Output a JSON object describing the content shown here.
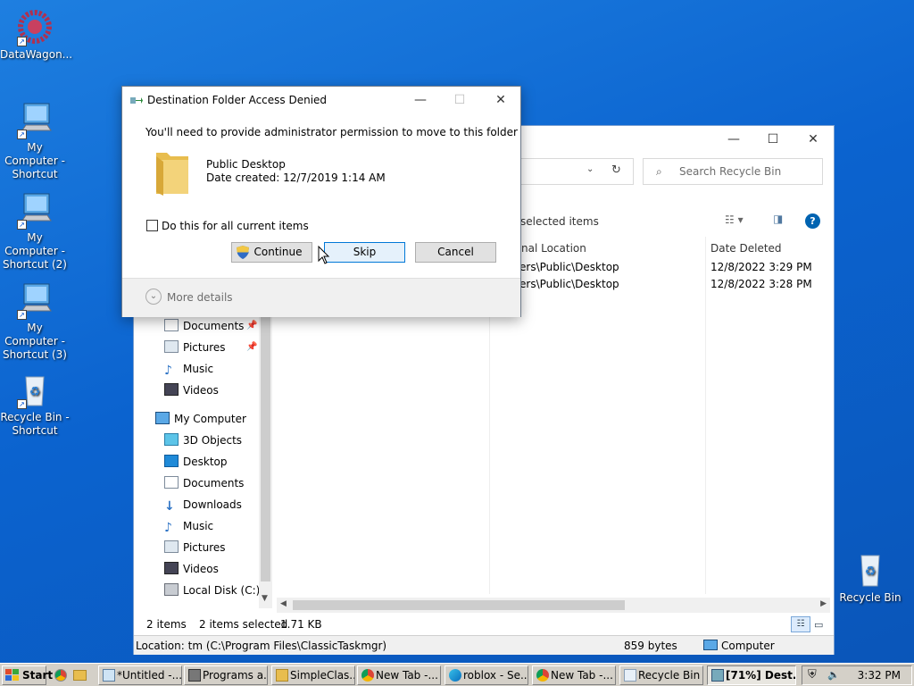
{
  "desktop": {
    "icons": [
      {
        "label": "DataWagon...",
        "shortcut": true
      },
      {
        "label": "My Computer - Shortcut",
        "shortcut": true
      },
      {
        "label": "My Computer - Shortcut (2)",
        "shortcut": true
      },
      {
        "label": "My Computer - Shortcut (3)",
        "shortcut": true
      },
      {
        "label": "Recycle Bin - Shortcut",
        "shortcut": true
      },
      {
        "label": "Recycle Bin",
        "shortcut": false
      }
    ]
  },
  "explorer": {
    "search_placeholder": "Search Recycle Bin",
    "command_label": "selected items",
    "columns": {
      "location": "nal Location",
      "date_deleted": "Date Deleted"
    },
    "rows": [
      {
        "location": "ers\\Public\\Desktop",
        "date_deleted": "12/8/2022 3:29 PM"
      },
      {
        "location": "ers\\Public\\Desktop",
        "date_deleted": "12/8/2022 3:28 PM"
      }
    ],
    "nav_items": [
      {
        "label": "Documents",
        "pinned": true,
        "indent": 1
      },
      {
        "label": "Pictures",
        "pinned": true,
        "indent": 1
      },
      {
        "label": "Music",
        "pinned": false,
        "indent": 1
      },
      {
        "label": "Videos",
        "pinned": false,
        "indent": 1
      },
      {
        "label": "My Computer",
        "pinned": false,
        "indent": 0
      },
      {
        "label": "3D Objects",
        "pinned": false,
        "indent": 1
      },
      {
        "label": "Desktop",
        "pinned": false,
        "indent": 1
      },
      {
        "label": "Documents",
        "pinned": false,
        "indent": 1
      },
      {
        "label": "Downloads",
        "pinned": false,
        "indent": 1
      },
      {
        "label": "Music",
        "pinned": false,
        "indent": 1
      },
      {
        "label": "Pictures",
        "pinned": false,
        "indent": 1
      },
      {
        "label": "Videos",
        "pinned": false,
        "indent": 1
      },
      {
        "label": "Local Disk (C:)",
        "pinned": false,
        "indent": 1
      }
    ],
    "status": {
      "count": "2 items",
      "selected": "2 items selected",
      "size": "1.71 KB"
    },
    "info": {
      "location": "Location: tm (C:\\Program Files\\ClassicTaskmgr)",
      "bytes": "859 bytes",
      "computer": "Computer"
    }
  },
  "dialog": {
    "title": "Destination Folder Access Denied",
    "message": "You'll need to provide administrator permission to move to this folder",
    "folder_name": "Public Desktop",
    "folder_date": "Date created: 12/7/2019 1:14 AM",
    "checkbox_label": "Do this for all current items",
    "continue_label": "Continue",
    "skip_label": "Skip",
    "cancel_label": "Cancel",
    "more_details": "More details"
  },
  "taskbar": {
    "start": "Start",
    "buttons": [
      {
        "label": "*Untitled -..."
      },
      {
        "label": "Programs a..."
      },
      {
        "label": "SimpleClas..."
      },
      {
        "label": "New Tab -..."
      },
      {
        "label": "roblox - Se..."
      },
      {
        "label": "New Tab -..."
      },
      {
        "label": "Recycle Bin"
      },
      {
        "label": "[71%] Dest..."
      }
    ],
    "clock": "3:32 PM"
  },
  "colors": {
    "desktop": "#0b63cf",
    "focus": "#0078d7",
    "folder": "#f3d37a",
    "help": "#0063b1"
  }
}
